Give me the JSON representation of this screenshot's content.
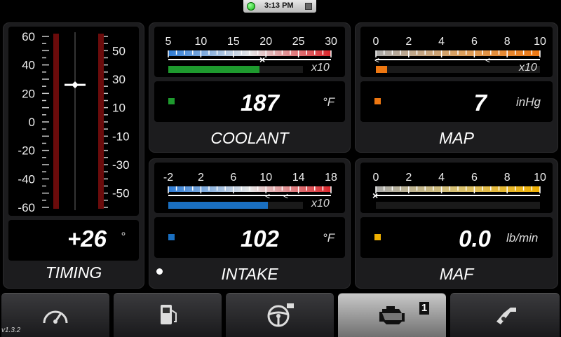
{
  "status_bar": {
    "time": "3:13 PM",
    "indicator_color": "#22cc22"
  },
  "timing": {
    "label": "TIMING",
    "value": "+26",
    "unit": "°",
    "current_value": 26,
    "left_scale_ticks": [
      "60",
      "40",
      "20",
      "0",
      "-20",
      "-40",
      "-60"
    ],
    "right_scale_ticks": [
      "50",
      "30",
      "10",
      "-10",
      "-30",
      "-50"
    ],
    "scale_range": [
      -60,
      60
    ]
  },
  "coolant": {
    "label": "COOLANT",
    "value": "187",
    "unit": "°F",
    "scale_ticks": [
      "5",
      "10",
      "15",
      "20",
      "25",
      "30"
    ],
    "multiplier": "x10",
    "accent_color": "#1e9a2e",
    "current_value": 187
  },
  "map": {
    "label": "MAP",
    "value": "7",
    "unit": "inHg",
    "scale_ticks": [
      "0",
      "2",
      "4",
      "6",
      "8",
      "10"
    ],
    "multiplier": "x10",
    "accent_color": "#ee7711",
    "current_value": 7
  },
  "intake": {
    "label": "INTAKE",
    "value": "102",
    "unit": "°F",
    "scale_ticks": [
      "-2",
      "2",
      "6",
      "10",
      "14",
      "18"
    ],
    "multiplier": "x10",
    "accent_color": "#1a6fc0",
    "current_value": 102
  },
  "maf": {
    "label": "MAF",
    "value": "0.0",
    "unit": "lb/min",
    "scale_ticks": [
      "0",
      "2",
      "4",
      "6",
      "8",
      "10"
    ],
    "accent_color": "#f0b000",
    "current_value": 0
  },
  "nav": {
    "items": [
      {
        "icon": "speedometer-icon"
      },
      {
        "icon": "fuel-pump-icon"
      },
      {
        "icon": "steering-wheel-icon"
      },
      {
        "icon": "check-engine-icon",
        "badge": "1",
        "active": true
      },
      {
        "icon": "fuel-nozzle-icon"
      }
    ]
  },
  "version": "v1.3.2"
}
